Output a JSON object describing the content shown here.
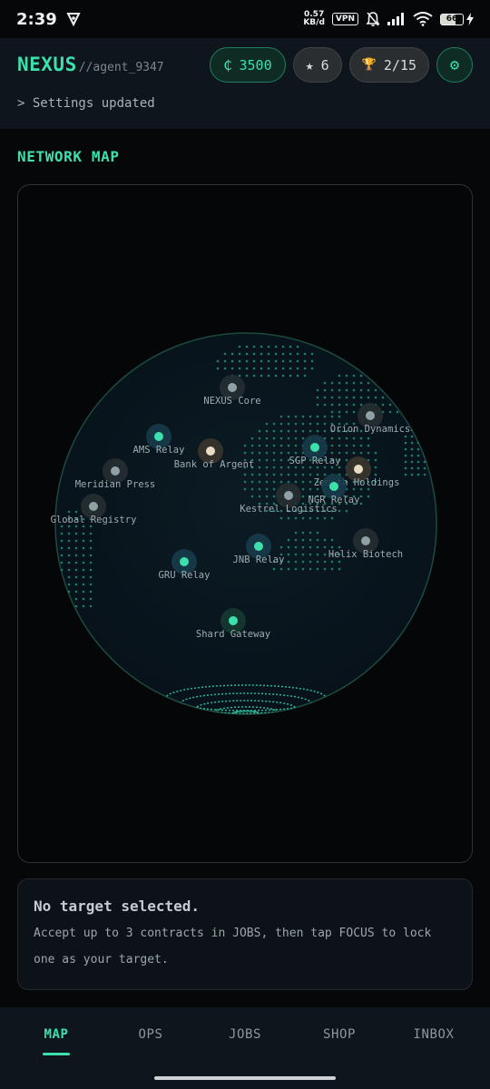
{
  "status_bar": {
    "time": "2:39",
    "net_speed_value": "0.57",
    "net_speed_unit": "KB/d",
    "vpn": "VPN",
    "battery": "66",
    "icons": [
      "vpn-app-icon",
      "network-speed-icon",
      "vpn-icon",
      "silent-icon",
      "signal-icon",
      "wifi-icon",
      "battery-icon",
      "charging-icon"
    ]
  },
  "header": {
    "brand": "NEXUS",
    "handle": "//agent_9347",
    "log": "> Settings updated",
    "credits": {
      "icon_glyph": "₵",
      "value": "3500"
    },
    "stars": {
      "icon_glyph": "★",
      "value": "6"
    },
    "trophies": {
      "icon_glyph": "🏆",
      "value": "2/15"
    },
    "settings_icon_glyph": "⚙"
  },
  "map": {
    "title": "NETWORK MAP",
    "nodes": [
      {
        "label": "NEXUS Core",
        "kind": "core"
      },
      {
        "label": "Orion Dynamics",
        "kind": "corp"
      },
      {
        "label": "AMS Relay",
        "kind": "relay"
      },
      {
        "label": "Bank of Argent",
        "kind": "bank"
      },
      {
        "label": "SGP Relay",
        "kind": "relay"
      },
      {
        "label": "Zenith Holdings",
        "kind": "bank"
      },
      {
        "label": "Meridian Press",
        "kind": "corp"
      },
      {
        "label": "NGR Relay",
        "kind": "relay"
      },
      {
        "label": "Kestrel Logistics",
        "kind": "corp"
      },
      {
        "label": "Global Registry",
        "kind": "corp"
      },
      {
        "label": "Helix Biotech",
        "kind": "corp"
      },
      {
        "label": "JNB Relay",
        "kind": "relay"
      },
      {
        "label": "GRU Relay",
        "kind": "relay"
      },
      {
        "label": "Shard Gateway",
        "kind": "gateway"
      }
    ]
  },
  "target": {
    "title": "No target selected.",
    "line1": "Accept up to 3 contracts in JOBS, then tap FOCUS to lock",
    "line2": "one as your target."
  },
  "nav": {
    "items": [
      {
        "label": "MAP",
        "active": true
      },
      {
        "label": "OPS",
        "active": false
      },
      {
        "label": "JOBS",
        "active": false
      },
      {
        "label": "SHOP",
        "active": false
      },
      {
        "label": "INBOX",
        "active": false
      }
    ]
  },
  "colors": {
    "accent": "#3de0ad",
    "bg": "#050709",
    "panel": "#0e151c",
    "relay_node": "#3de0ad",
    "bank_node": "#e8dcc4",
    "corp_node": "#8fa0a6"
  }
}
